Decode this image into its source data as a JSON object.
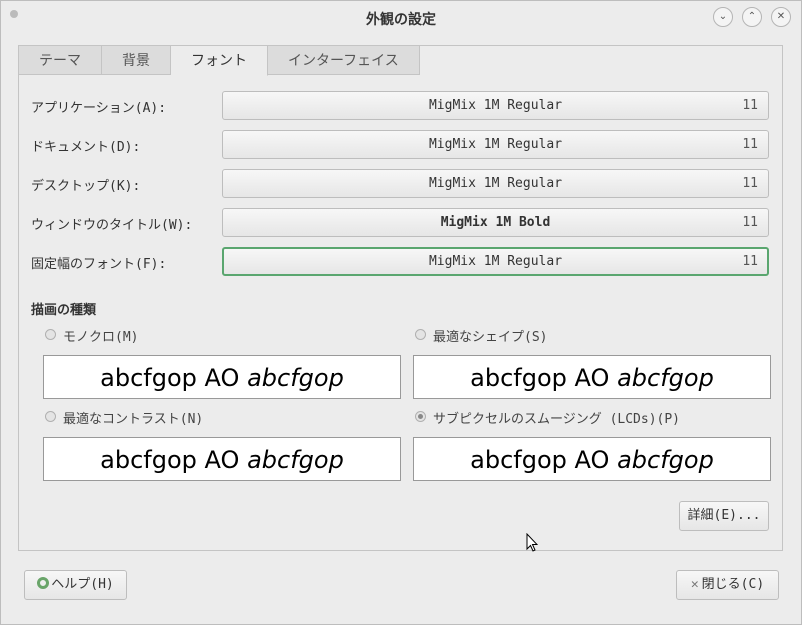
{
  "window": {
    "title": "外観の設定"
  },
  "window_buttons": {
    "minimize": "⌄",
    "maximize": "⌃",
    "close": "✕"
  },
  "tabs": [
    {
      "label": "テーマ",
      "active": false
    },
    {
      "label": "背景",
      "active": false
    },
    {
      "label": "フォント",
      "active": true
    },
    {
      "label": "インターフェイス",
      "active": false
    }
  ],
  "font_rows": [
    {
      "label": "アプリケーション(A):",
      "font": "MigMix 1M Regular",
      "size": "11"
    },
    {
      "label": "ドキュメント(D):",
      "font": "MigMix 1M Regular",
      "size": "11"
    },
    {
      "label": "デスクトップ(K):",
      "font": "MigMix 1M Regular",
      "size": "11"
    },
    {
      "label": "ウィンドウのタイトル(W):",
      "font": "MigMix 1M Bold",
      "size": "11"
    },
    {
      "label": "固定幅のフォント(F):",
      "font": "MigMix 1M Regular",
      "size": "11"
    }
  ],
  "rendering": {
    "heading": "描画の種類",
    "options": [
      {
        "label": "モノクロ(M)",
        "checked": false,
        "preview_regular": "abcfgop AO",
        "preview_italic": "abcfgop"
      },
      {
        "label": "最適なシェイプ(S)",
        "checked": false,
        "preview_regular": "abcfgop AO",
        "preview_italic": "abcfgop"
      },
      {
        "label": "最適なコントラスト(N)",
        "checked": false,
        "preview_regular": "abcfgop AO",
        "preview_italic": "abcfgop"
      },
      {
        "label": "サブピクセルのスムージング (LCDs)(P)",
        "checked": true,
        "preview_regular": "abcfgop AO",
        "preview_italic": "abcfgop"
      }
    ]
  },
  "buttons": {
    "details": "詳細(E)...",
    "help": "ヘルプ(H)",
    "close": "閉じる(C)"
  },
  "colors": {
    "focus_border": "#5aa66f",
    "window_bg": "#ececec"
  }
}
